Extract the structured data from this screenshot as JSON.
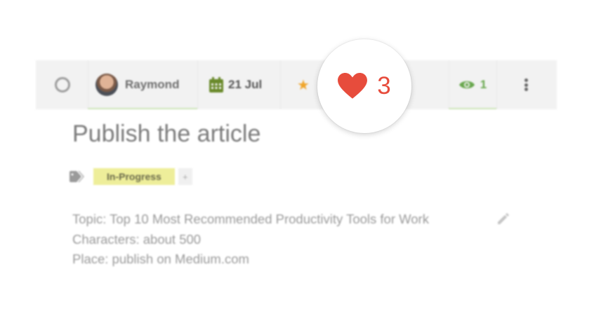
{
  "toolbar": {
    "assignee": {
      "name": "Raymond"
    },
    "due_date": "21 Jul",
    "watchers_count": "1",
    "icons": [
      "complete-circle-icon",
      "calendar-icon",
      "star-icon",
      "eye-icon",
      "more-vert-icon"
    ]
  },
  "likes": {
    "count": "3",
    "icon": "heart-icon",
    "color": "#e74c3c"
  },
  "task": {
    "title": "Publish the article",
    "tags": [
      "In-Progress"
    ],
    "add_tag_label": "+",
    "description": [
      "Topic: Top 10 Most Recommended Productivity Tools for Work",
      "Characters: about 500",
      "Place: publish on Medium.com"
    ]
  },
  "colors": {
    "accent_green": "#6aa84f",
    "tag_yellow": "#eeee9a",
    "star": "#f0a52b"
  }
}
